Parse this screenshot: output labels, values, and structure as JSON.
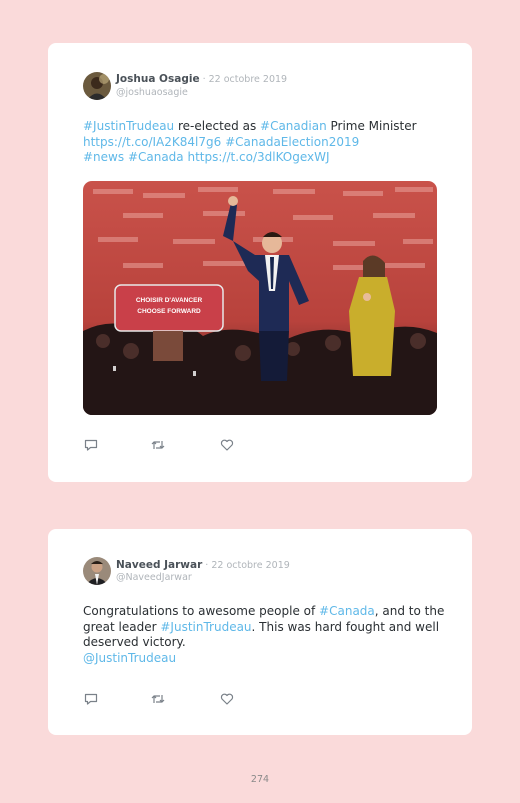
{
  "tweets": [
    {
      "name": "Joshua Osagie",
      "date": " · 22 octobre 2019",
      "handle": "@joshuaosagie",
      "lines": [
        [
          {
            "t": "#JustinTrudeau",
            "link": true
          },
          {
            "t": " re-elected as ",
            "link": false
          },
          {
            "t": "#Canadian",
            "link": true
          },
          {
            "t": " Prime Minister",
            "link": false
          }
        ],
        [
          {
            "t": "https://t.co/IA2K84l7g6",
            "link": true
          },
          {
            "t": " ",
            "link": false
          },
          {
            "t": "#CanadaElection2019",
            "link": true
          }
        ],
        [
          {
            "t": "#news",
            "link": true
          },
          {
            "t": " ",
            "link": false
          },
          {
            "t": "#Canada",
            "link": true
          },
          {
            "t": " ",
            "link": false
          },
          {
            "t": "https://t.co/3dlKOgexWJ",
            "link": true
          }
        ]
      ],
      "photo_signs": [
        "CHOISIR D'AVANCER",
        "CHOOSE FORWARD"
      ]
    },
    {
      "name": "Naveed Jarwar",
      "date": " · 22 octobre 2019",
      "handle": "@NaveedJarwar",
      "lines": [
        [
          {
            "t": "Congratulations to awesome people of ",
            "link": false
          },
          {
            "t": "#Canada",
            "link": true
          },
          {
            "t": ", and to the",
            "link": false
          }
        ],
        [
          {
            "t": "great leader ",
            "link": false
          },
          {
            "t": "#JustinTrudeau",
            "link": true
          },
          {
            "t": ". This was hard fought and well",
            "link": false
          }
        ],
        [
          {
            "t": "deserved victory.",
            "link": false
          }
        ],
        [
          {
            "t": "@JustinTrudeau",
            "link": true
          }
        ]
      ]
    }
  ],
  "page_number": "274",
  "colors": {
    "background": "#fadada",
    "link": "#5fb8e8",
    "stage_red": "#c8463f",
    "podium": "#c94049"
  },
  "icons": [
    "reply-icon",
    "retweet-icon",
    "like-icon"
  ]
}
